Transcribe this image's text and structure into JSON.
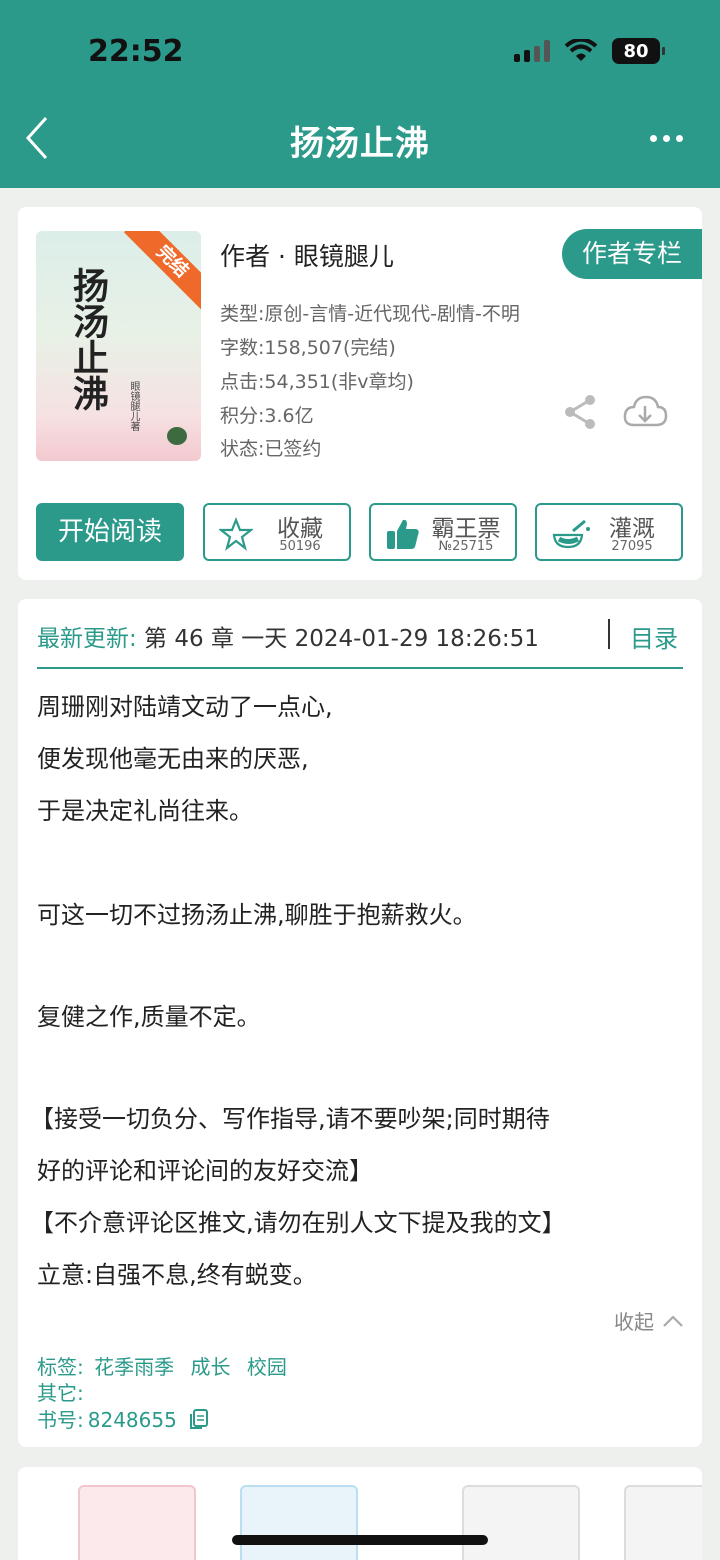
{
  "status_bar": {
    "time": "22:52",
    "battery": "80"
  },
  "nav": {
    "title": "扬汤止沸"
  },
  "book": {
    "cover_title": "扬汤止沸",
    "cover_author": "眼镜腿儿著",
    "cover_ribbon": "完结",
    "author": "作者 · 眼镜腿儿",
    "author_column_button": "作者专栏",
    "type": "类型:原创-言情-近代现代-剧情-不明",
    "word_count": "字数:158,507(完结)",
    "clicks": "点击:54,351(非v章均)",
    "points": "积分:3.6亿",
    "status": "状态:已签约"
  },
  "actions": {
    "read": "开始阅读",
    "favorite": {
      "label": "收藏",
      "count": "50196"
    },
    "overlord": {
      "label": "霸王票",
      "count": "№25715"
    },
    "nutrient": {
      "label": "灌溉",
      "count": "27095"
    }
  },
  "update": {
    "label": "最新更新:",
    "text": " 第 46 章 一天 2024-01-29 18:26:51",
    "toc": "目录"
  },
  "synopsis": {
    "lines": [
      "周珊刚对陆靖文动了一点心,",
      "便发现他毫无由来的厌恶,",
      "于是决定礼尚往来。",
      "可这一切不过扬汤止沸,聊胜于抱薪救火。",
      "复健之作,质量不定。",
      "【接受一切负分、写作指导,请不要吵架;同时期待",
      "好的评论和评论间的友好交流】",
      "【不介意评论区推文,请勿在别人文下提及我的文】",
      "立意:自强不息,终有蜕变。"
    ],
    "collapse": "收起"
  },
  "tags": {
    "tag_label": "标签:",
    "tag_items": [
      "花季雨季",
      "成长",
      "校园"
    ],
    "other_label": "其它:",
    "book_no_label": "书号:",
    "book_no": "8248655"
  },
  "colors": {
    "accent": "#2b9a8b",
    "background": "#eef0ee",
    "ribbon": "#ef6a2a"
  }
}
